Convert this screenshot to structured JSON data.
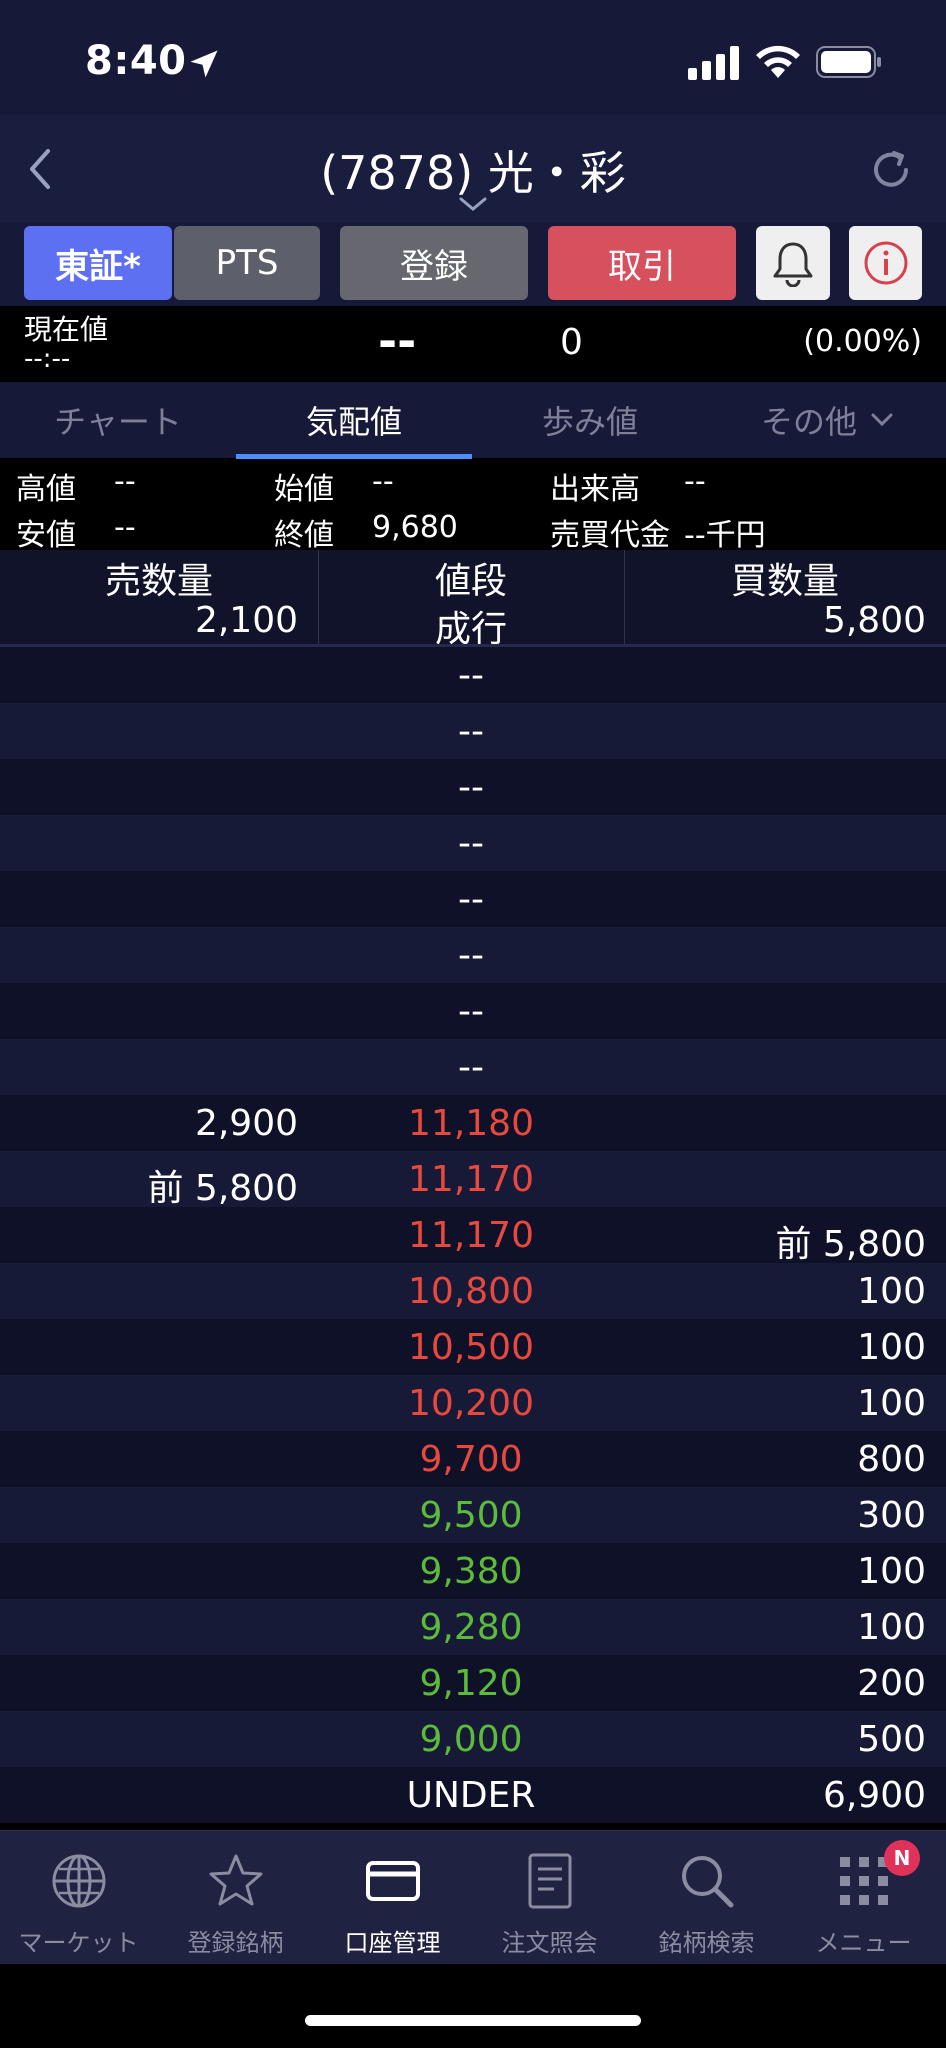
{
  "status": {
    "time": "8:40"
  },
  "header": {
    "title": "(7878) 光・彩"
  },
  "toolbar": {
    "tosho": "東証*",
    "pts": "PTS",
    "toroku": "登録",
    "torihiki": "取引"
  },
  "price": {
    "label": "現在値",
    "time": "--:--",
    "value": "--",
    "change": "0",
    "pct": "(0.00%)"
  },
  "tabs": [
    "チャート",
    "気配値",
    "歩み値",
    "その他"
  ],
  "stats": {
    "high_label": "高値",
    "high": "--",
    "open_label": "始値",
    "open": "--",
    "volume_label": "出来高",
    "volume": "--",
    "low_label": "安値",
    "low": "--",
    "close_label": "終値",
    "close": "9,680",
    "turnover_label": "売買代金",
    "turnover": "--千円"
  },
  "board": {
    "sell_header": "売数量",
    "price_header": "値段",
    "buy_header": "買数量",
    "market_sell": "2,100",
    "market_label": "成行",
    "market_buy": "5,800",
    "rows": [
      {
        "sell": "",
        "price": "--",
        "buy": "",
        "color": ""
      },
      {
        "sell": "",
        "price": "--",
        "buy": "",
        "color": ""
      },
      {
        "sell": "",
        "price": "--",
        "buy": "",
        "color": ""
      },
      {
        "sell": "",
        "price": "--",
        "buy": "",
        "color": ""
      },
      {
        "sell": "",
        "price": "--",
        "buy": "",
        "color": ""
      },
      {
        "sell": "",
        "price": "--",
        "buy": "",
        "color": ""
      },
      {
        "sell": "",
        "price": "--",
        "buy": "",
        "color": ""
      },
      {
        "sell": "",
        "price": "--",
        "buy": "",
        "color": ""
      },
      {
        "sell": "2,900",
        "price": "11,180",
        "buy": "",
        "color": "red"
      },
      {
        "sell": "前 5,800",
        "price": "11,170",
        "buy": "",
        "color": "red"
      },
      {
        "sell": "",
        "price": "11,170",
        "buy": "前 5,800",
        "color": "red"
      },
      {
        "sell": "",
        "price": "10,800",
        "buy": "100",
        "color": "red"
      },
      {
        "sell": "",
        "price": "10,500",
        "buy": "100",
        "color": "red"
      },
      {
        "sell": "",
        "price": "10,200",
        "buy": "100",
        "color": "red"
      },
      {
        "sell": "",
        "price": "9,700",
        "buy": "800",
        "color": "red"
      },
      {
        "sell": "",
        "price": "9,500",
        "buy": "300",
        "color": "green"
      },
      {
        "sell": "",
        "price": "9,380",
        "buy": "100",
        "color": "green"
      },
      {
        "sell": "",
        "price": "9,280",
        "buy": "100",
        "color": "green"
      },
      {
        "sell": "",
        "price": "9,120",
        "buy": "200",
        "color": "green"
      },
      {
        "sell": "",
        "price": "9,000",
        "buy": "500",
        "color": "green"
      },
      {
        "sell": "",
        "price": "UNDER",
        "buy": "6,900",
        "color": ""
      }
    ]
  },
  "nav": [
    {
      "label": "マーケット",
      "icon": "globe-icon"
    },
    {
      "label": "登録銘柄",
      "icon": "star-icon"
    },
    {
      "label": "口座管理",
      "icon": "card-icon"
    },
    {
      "label": "注文照会",
      "icon": "document-icon"
    },
    {
      "label": "銘柄検索",
      "icon": "search-icon"
    },
    {
      "label": "メニュー",
      "icon": "grid-icon"
    }
  ],
  "badge": "N",
  "colors": {
    "accent": "#4d8dff",
    "red": "#e8493e",
    "green": "#5dbb3a",
    "tosho": "#5e70f2",
    "torihiki": "#d6505e"
  }
}
